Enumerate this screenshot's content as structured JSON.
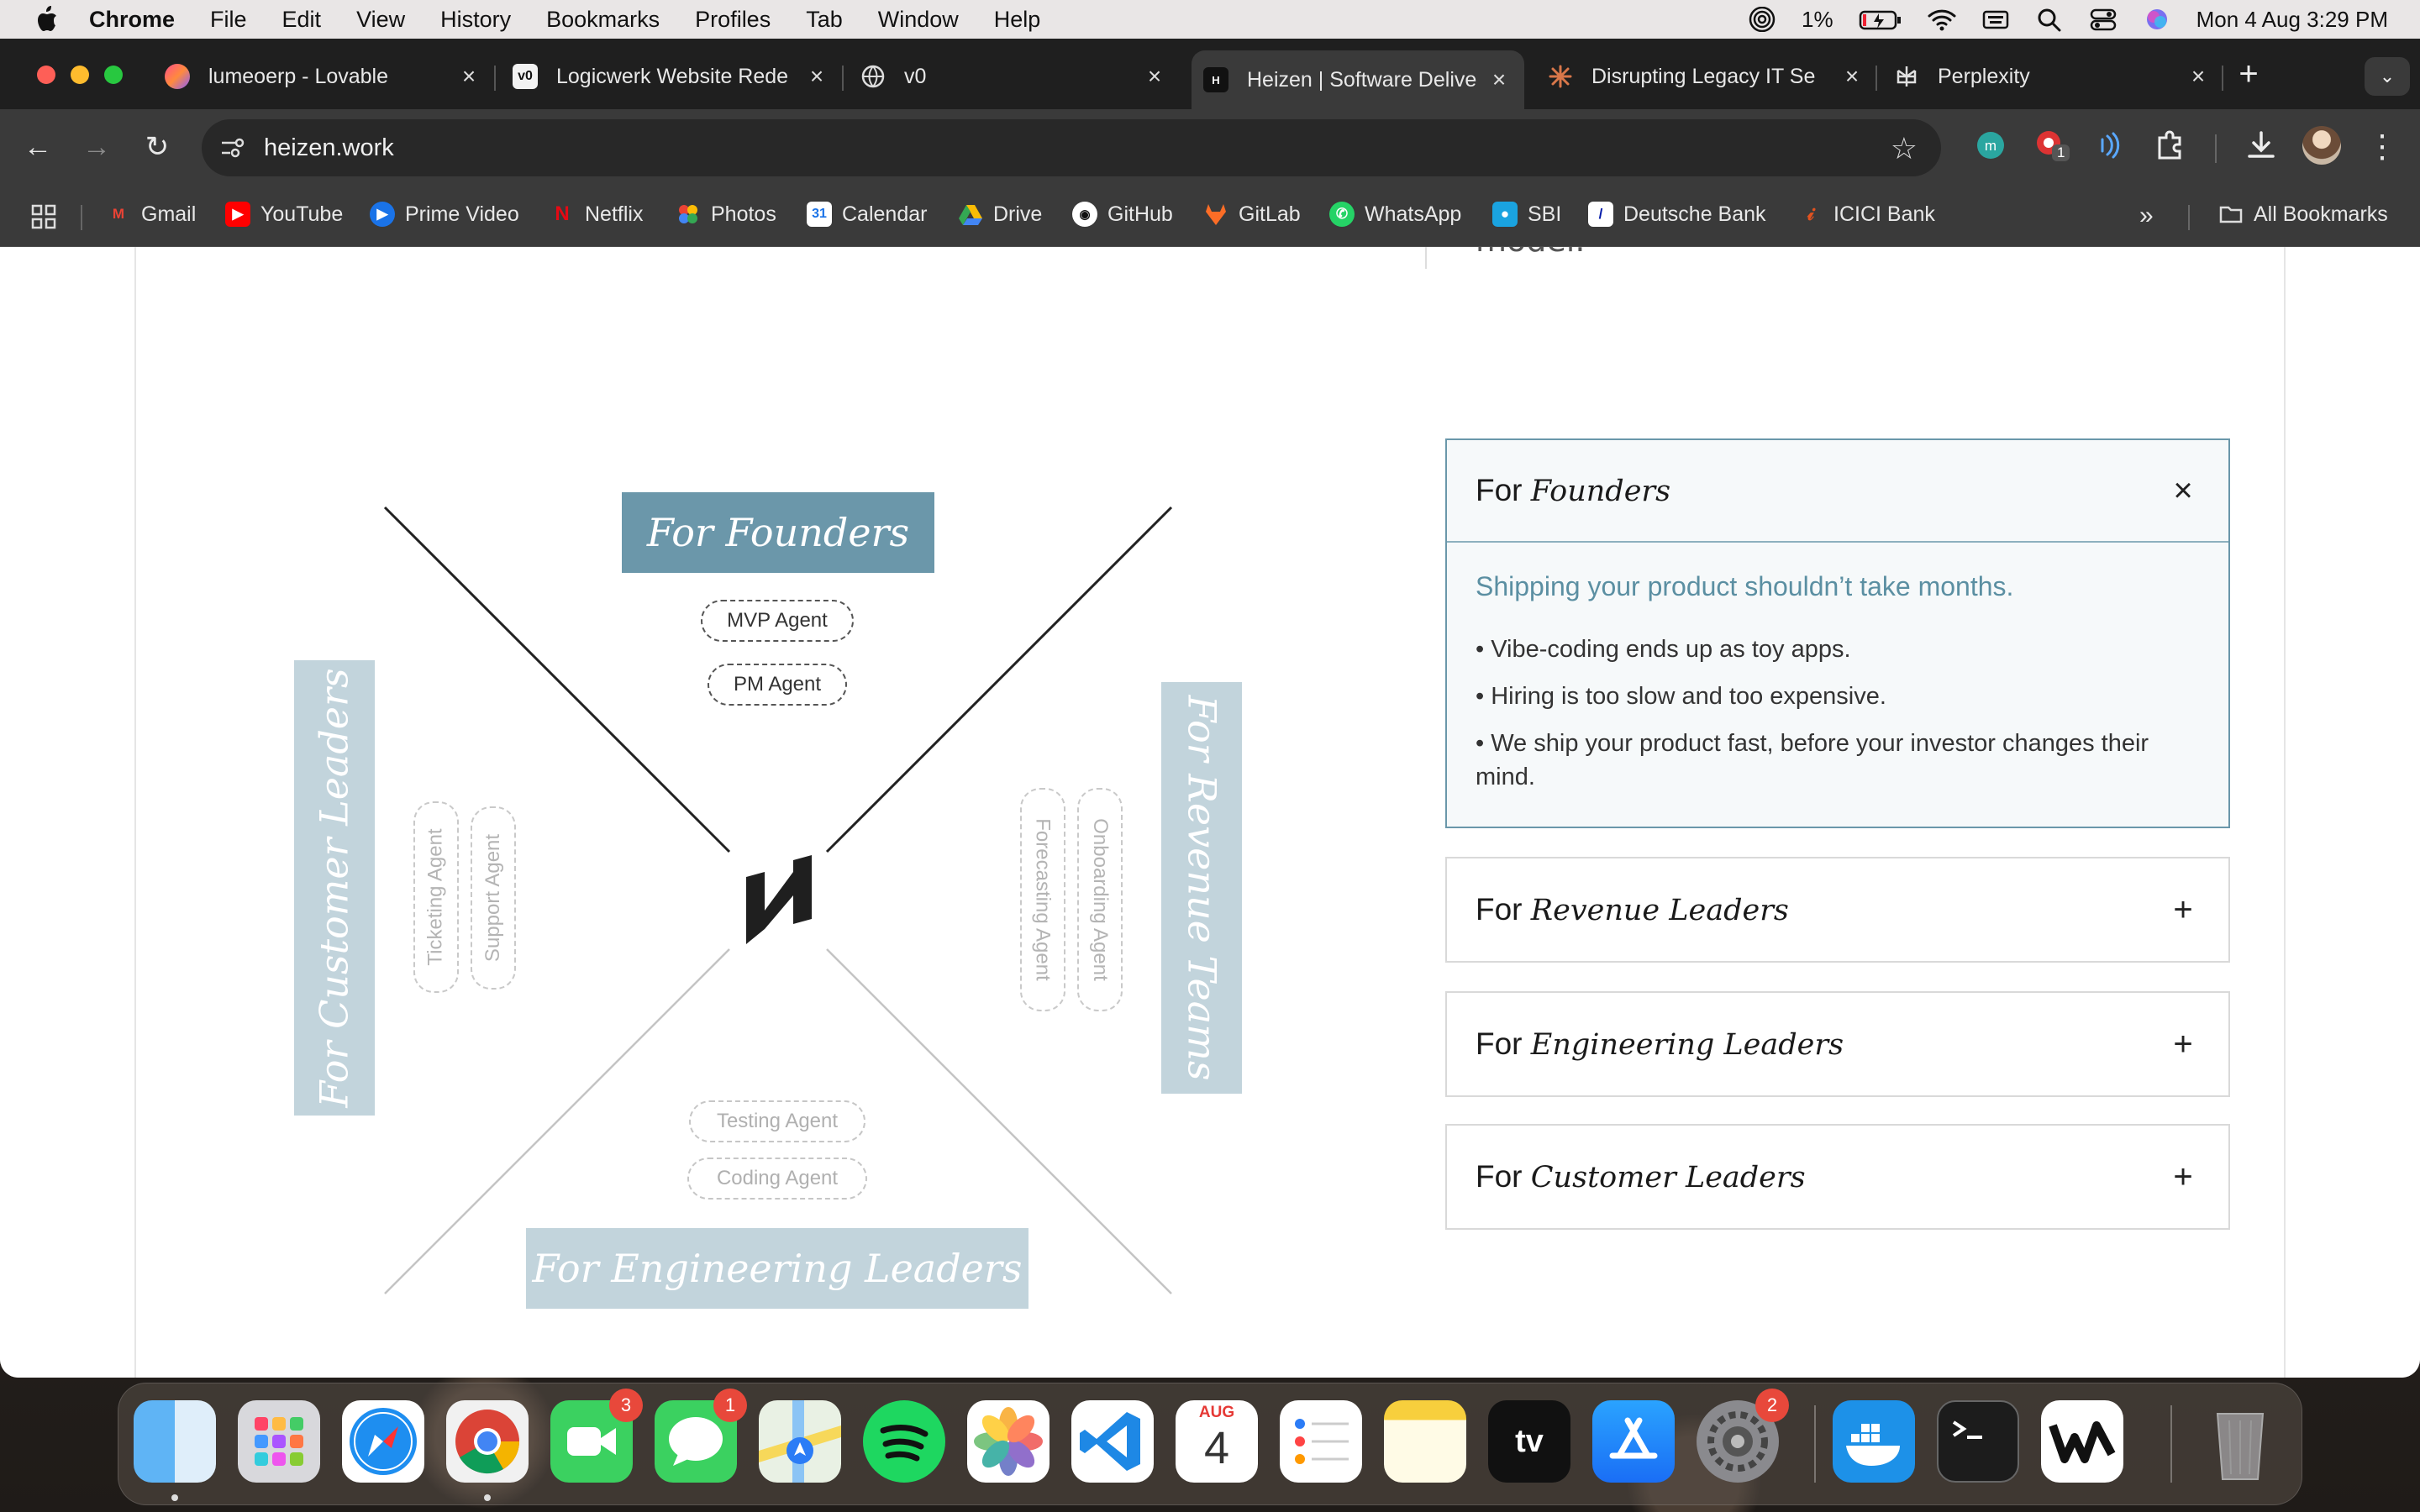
{
  "menubar": {
    "app": "Chrome",
    "items": [
      "File",
      "Edit",
      "View",
      "History",
      "Bookmarks",
      "Profiles",
      "Tab",
      "Window",
      "Help"
    ],
    "battery": "1%",
    "datetime": "Mon 4 Aug  3:29 PM"
  },
  "tabs": [
    {
      "title": "lumeoerp - Lovable"
    },
    {
      "title": "Logicwerk Website Rede"
    },
    {
      "title": "v0"
    },
    {
      "title": "Heizen | Software Delive"
    },
    {
      "title": "Disrupting Legacy IT Se"
    },
    {
      "title": "Perplexity"
    }
  ],
  "omnibox": {
    "url": "heizen.work"
  },
  "extensions": {
    "badge": "1"
  },
  "bookmarks": [
    "Gmail",
    "YouTube",
    "Prime Video",
    "Netflix",
    "Photos",
    "Calendar",
    "Drive",
    "GitHub",
    "GitLab",
    "WhatsApp",
    "SBI",
    "Deutsche Bank",
    "ICICI Bank"
  ],
  "bookmarks_overflow": "»",
  "all_bookmarks": "All Bookmarks",
  "page": {
    "cut_text": "model.",
    "diagram": {
      "top_label": "For Founders",
      "top_agents": [
        "MVP Agent",
        "PM Agent"
      ],
      "left_label": "For Customer Leaders",
      "left_agents": [
        "Ticketing Agent",
        "Support Agent"
      ],
      "right_label": "For Revenue Teams",
      "right_agents": [
        "Forecasting Agent",
        "Onboarding Agent"
      ],
      "bottom_label": "For Engineering Leaders",
      "bottom_agents": [
        "Testing Agent",
        "Coding Agent"
      ]
    },
    "accordion": [
      {
        "prefix": "For",
        "title": "Founders",
        "state": "open",
        "sign": "×",
        "tagline": "Shipping your product shouldn’t take months.",
        "bullets": [
          "• Vibe-coding ends up as toy apps.",
          "• Hiring is too slow and too expensive.",
          "• We ship your product fast, before your investor changes their mind."
        ]
      },
      {
        "prefix": "For",
        "title": "Revenue Leaders",
        "state": "closed",
        "sign": "+"
      },
      {
        "prefix": "For",
        "title": "Engineering Leaders",
        "state": "closed",
        "sign": "+"
      },
      {
        "prefix": "For",
        "title": "Customer Leaders",
        "state": "closed",
        "sign": "+"
      }
    ]
  },
  "dock": {
    "facetime_badge": "3",
    "messages_badge": "1",
    "calendar_month": "AUG",
    "calendar_day": "4",
    "settings_badge": "2",
    "tv_label": "tv"
  },
  "colors": {
    "accent_blue": "#6b97aa",
    "faded_blue": "#c2d4dc",
    "accordion_border_active": "#6a97aa"
  }
}
